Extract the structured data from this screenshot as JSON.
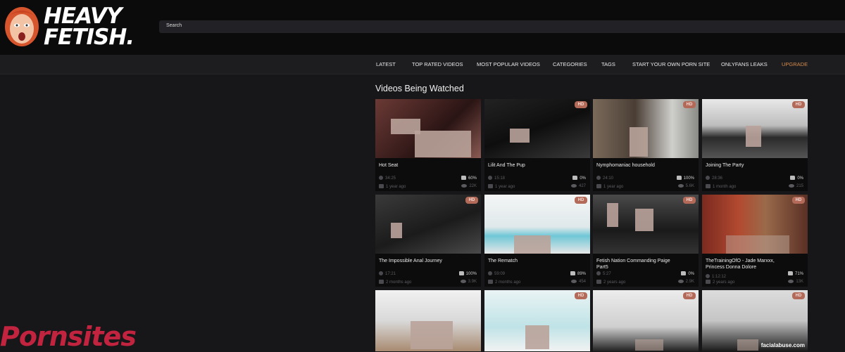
{
  "header": {
    "logo_line1": "HEAVY",
    "logo_line2": "FETISH.",
    "search_label": "Search"
  },
  "nav": [
    {
      "label": "LATEST"
    },
    {
      "label": "TOP RATED VIDEOS"
    },
    {
      "label": "MOST POPULAR VIDEOS"
    },
    {
      "label": "CATEGORIES"
    },
    {
      "label": "TAGS"
    },
    {
      "label": "START YOUR OWN PORN SITE"
    },
    {
      "label": "ONLYFANS LEAKS"
    },
    {
      "label": "UPGRADE"
    }
  ],
  "section_title": "Videos Being Watched",
  "videos": [
    {
      "title": "Hot Seat",
      "duration": "34:25",
      "age": "1 year ago",
      "rating": "60%",
      "views": "22K",
      "hd": ""
    },
    {
      "title": "Lilit And The Pup",
      "duration": "15:18",
      "age": "1 year ago",
      "rating": "0%",
      "views": "427",
      "hd": "HD"
    },
    {
      "title": "Nymphomaniac household",
      "duration": "24:10",
      "age": "1 year ago",
      "rating": "100%",
      "views": "5.6K",
      "hd": "HD"
    },
    {
      "title": "Joining The Party",
      "duration": "28:36",
      "age": "1 month ago",
      "rating": "0%",
      "views": "215",
      "hd": "HD"
    },
    {
      "title": "The Impossible Anal Journey",
      "duration": "17:21",
      "age": "2 months ago",
      "rating": "100%",
      "views": "3.9K",
      "hd": "HD"
    },
    {
      "title": "The Rematch",
      "duration": "59:09",
      "age": "2 months ago",
      "rating": "89%",
      "views": "454",
      "hd": "HD"
    },
    {
      "title": "Fetish Nation Commanding Paige Part5",
      "duration": "5:27",
      "age": "2 years ago",
      "rating": "0%",
      "views": "2.9K",
      "hd": "HD"
    },
    {
      "title": "TheTrainingOfO - Jade Marxxx, Princess Donna Dolore",
      "duration": "1:12:12",
      "age": "2 years ago",
      "rating": "71%",
      "views": "13K",
      "hd": "HD"
    },
    {
      "title": "",
      "duration": "",
      "age": "",
      "rating": "",
      "views": "",
      "hd": ""
    },
    {
      "title": "",
      "duration": "",
      "age": "",
      "rating": "",
      "views": "",
      "hd": "HD"
    },
    {
      "title": "",
      "duration": "",
      "age": "",
      "rating": "",
      "views": "",
      "hd": "HD"
    },
    {
      "title": "",
      "duration": "",
      "age": "",
      "rating": "",
      "views": "",
      "hd": "HD"
    }
  ],
  "watermark": "Pornsites",
  "thumb_watermark": "facialabuse.com"
}
